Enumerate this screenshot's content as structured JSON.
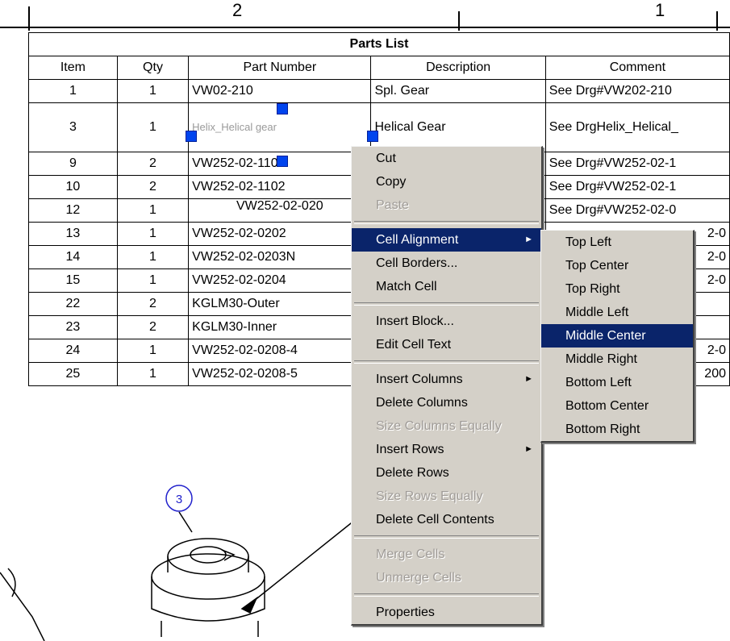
{
  "border": {
    "left_number": "2",
    "right_number": "1"
  },
  "table": {
    "title": "Parts List",
    "headers": [
      "Item",
      "Qty",
      "Part Number",
      "Description",
      "Comment"
    ],
    "rows": [
      {
        "item": "1",
        "qty": "1",
        "part": "VW02-210",
        "desc": "Spl. Gear",
        "comment": "See Drg#VW202-210"
      },
      {
        "item": "3",
        "qty": "1",
        "part": "Helix_Helical gear",
        "desc": "Helical Gear",
        "comment": "See DrgHelix_Helical_"
      },
      {
        "item": "9",
        "qty": "2",
        "part": "VW252-02-1101",
        "desc": "",
        "comment": "See Drg#VW252-02-1"
      },
      {
        "item": "10",
        "qty": "2",
        "part": "VW252-02-1102",
        "desc": "",
        "comment": "See Drg#VW252-02-1"
      },
      {
        "item": "12",
        "qty": "1",
        "part": "VW252-02-020",
        "desc": "",
        "comment": "See Drg#VW252-02-0"
      },
      {
        "item": "13",
        "qty": "1",
        "part": "VW252-02-0202",
        "desc": "",
        "comment": "2-0"
      },
      {
        "item": "14",
        "qty": "1",
        "part": "VW252-02-0203N",
        "desc": "",
        "comment": "2-0"
      },
      {
        "item": "15",
        "qty": "1",
        "part": "VW252-02-0204",
        "desc": "",
        "comment": "2-0"
      },
      {
        "item": "22",
        "qty": "2",
        "part": "KGLM30-Outer",
        "desc": "",
        "comment": ""
      },
      {
        "item": "23",
        "qty": "2",
        "part": "KGLM30-Inner",
        "desc": "",
        "comment": ""
      },
      {
        "item": "24",
        "qty": "1",
        "part": "VW252-02-0208-4",
        "desc": "",
        "comment": "2-0"
      },
      {
        "item": "25",
        "qty": "1",
        "part": "VW252-02-0208-5",
        "desc": "",
        "comment": "200"
      }
    ]
  },
  "balloon": {
    "number": "3"
  },
  "context_menu": {
    "items": [
      {
        "label": "Cut",
        "state": "normal"
      },
      {
        "label": "Copy",
        "state": "normal"
      },
      {
        "label": "Paste",
        "state": "disabled"
      },
      {
        "sep": true
      },
      {
        "label": "Cell Alignment",
        "state": "highlighted",
        "submenu": true
      },
      {
        "label": "Cell Borders...",
        "state": "normal"
      },
      {
        "label": "Match Cell",
        "state": "normal"
      },
      {
        "sep": true
      },
      {
        "label": "Insert Block...",
        "state": "normal"
      },
      {
        "label": "Edit Cell Text",
        "state": "normal"
      },
      {
        "sep": true
      },
      {
        "label": "Insert Columns",
        "state": "normal",
        "submenu": true
      },
      {
        "label": "Delete Columns",
        "state": "normal"
      },
      {
        "label": "Size Columns Equally",
        "state": "disabled"
      },
      {
        "label": "Insert Rows",
        "state": "normal",
        "submenu": true
      },
      {
        "label": "Delete Rows",
        "state": "normal"
      },
      {
        "label": "Size Rows Equally",
        "state": "disabled"
      },
      {
        "label": "Delete Cell Contents",
        "state": "normal"
      },
      {
        "sep": true
      },
      {
        "label": "Merge Cells",
        "state": "disabled"
      },
      {
        "label": "Unmerge Cells",
        "state": "disabled"
      },
      {
        "sep": true
      },
      {
        "label": "Properties",
        "state": "normal"
      }
    ]
  },
  "submenu": {
    "items": [
      {
        "label": "Top Left",
        "state": "normal"
      },
      {
        "label": "Top Center",
        "state": "normal"
      },
      {
        "label": "Top Right",
        "state": "normal"
      },
      {
        "label": "Middle Left",
        "state": "normal"
      },
      {
        "label": "Middle Center",
        "state": "highlighted"
      },
      {
        "label": "Middle Right",
        "state": "normal"
      },
      {
        "label": "Bottom Left",
        "state": "normal"
      },
      {
        "label": "Bottom Center",
        "state": "normal"
      },
      {
        "label": "Bottom Right",
        "state": "normal"
      }
    ]
  },
  "colors": {
    "menu_bg": "#d4d0c8",
    "highlight": "#0a246a",
    "grip": "#0044ee",
    "balloon": "#2222cc"
  }
}
